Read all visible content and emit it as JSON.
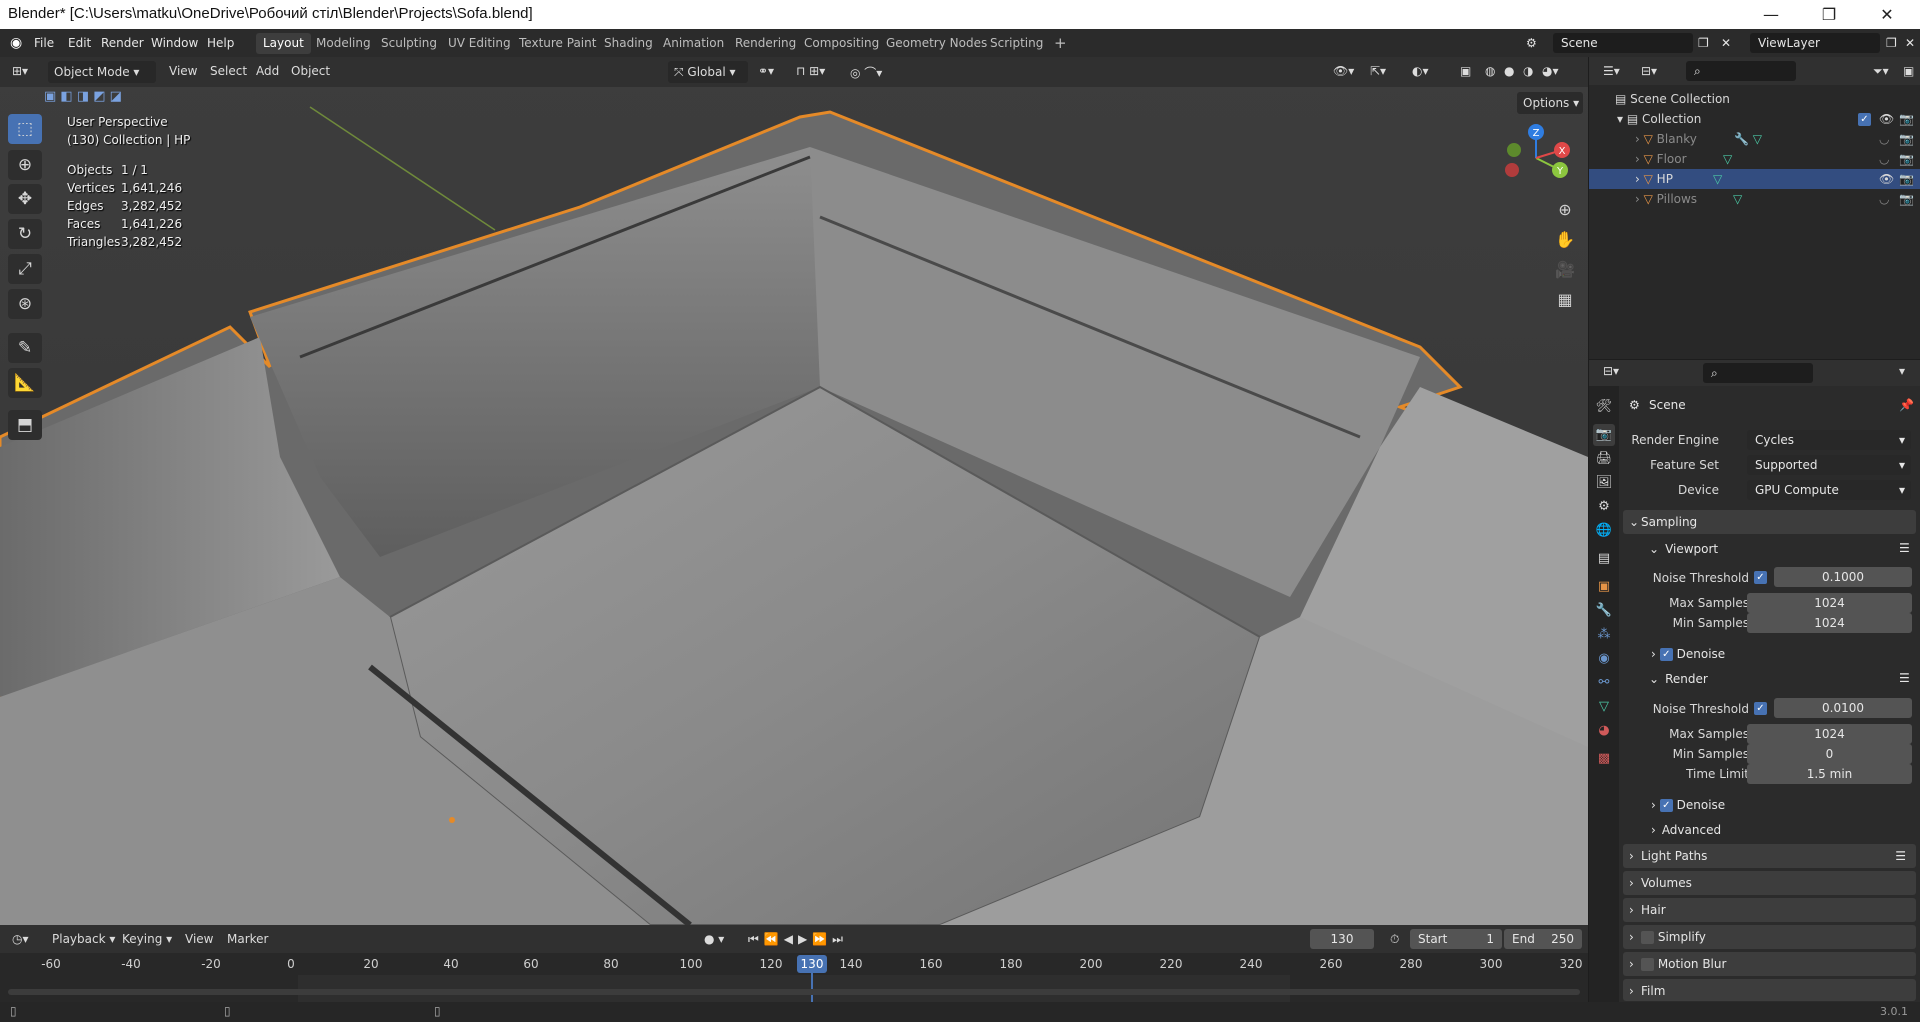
{
  "window": {
    "title": "Blender* [C:\\Users\\matku\\OneDrive\\Робочий стіл\\Blender\\Projects\\Sofa.blend]",
    "minimize": "—",
    "maximize": "❐",
    "close": "✕"
  },
  "menu": {
    "items": [
      "File",
      "Edit",
      "Render",
      "Window",
      "Help"
    ],
    "workspaces": [
      "Layout",
      "Modeling",
      "Sculpting",
      "UV Editing",
      "Texture Paint",
      "Shading",
      "Animation",
      "Rendering",
      "Compositing",
      "Geometry Nodes",
      "Scripting"
    ],
    "active_workspace": "Layout",
    "add_workspace": "+",
    "scene": "Scene",
    "view_layer": "ViewLayer"
  },
  "viewport": {
    "mode": "Object Mode",
    "menus": [
      "View",
      "Select",
      "Add",
      "Object"
    ],
    "transform_orientation": "Global",
    "options_label": "Options",
    "view_name": "User Perspective",
    "collection_info": "(130) Collection | HP",
    "stats": [
      {
        "label": "Objects",
        "value": "1 / 1"
      },
      {
        "label": "Vertices",
        "value": "1,641,246"
      },
      {
        "label": "Edges",
        "value": "3,282,452"
      },
      {
        "label": "Faces",
        "value": "1,641,226"
      },
      {
        "label": "Triangles",
        "value": "3,282,452"
      }
    ],
    "gizmo": {
      "x": "X",
      "y": "Y",
      "z": "Z"
    }
  },
  "timeline": {
    "menus": [
      "Playback",
      "Keying",
      "View",
      "Marker"
    ],
    "current_frame": "130",
    "start_label": "Start",
    "start": "1",
    "end_label": "End",
    "end": "250",
    "ticks": [
      "-60",
      "-40",
      "-20",
      "0",
      "20",
      "40",
      "60",
      "80",
      "100",
      "120",
      "140",
      "160",
      "180",
      "200",
      "220",
      "240",
      "260",
      "280",
      "300",
      "320"
    ],
    "playhead": "130"
  },
  "status": {
    "version": "3.0.1"
  },
  "outliner": {
    "root": "Scene Collection",
    "collection": "Collection",
    "objects": [
      {
        "name": "Blanky",
        "selected": false
      },
      {
        "name": "Floor",
        "selected": false
      },
      {
        "name": "HP",
        "selected": true
      },
      {
        "name": "Pillows",
        "selected": false
      }
    ]
  },
  "properties": {
    "context": "Scene",
    "render_engine_label": "Render Engine",
    "render_engine": "Cycles",
    "feature_set_label": "Feature Set",
    "feature_set": "Supported",
    "device_label": "Device",
    "device": "GPU Compute",
    "sampling": "Sampling",
    "viewport_section": "Viewport",
    "viewport": {
      "noise_threshold_label": "Noise Threshold",
      "noise_threshold": "0.1000",
      "max_samples_label": "Max Samples",
      "max_samples": "1024",
      "min_samples_label": "Min Samples",
      "min_samples": "1024",
      "denoise": "Denoise"
    },
    "render_section": "Render",
    "render": {
      "noise_threshold_label": "Noise Threshold",
      "noise_threshold": "0.0100",
      "max_samples_label": "Max Samples",
      "max_samples": "1024",
      "min_samples_label": "Min Samples",
      "min_samples": "0",
      "time_limit_label": "Time Limit",
      "time_limit": "1.5 min",
      "denoise": "Denoise"
    },
    "advanced": "Advanced",
    "panels": [
      "Light Paths",
      "Volumes",
      "Hair",
      "Simplify",
      "Motion Blur",
      "Film"
    ]
  }
}
